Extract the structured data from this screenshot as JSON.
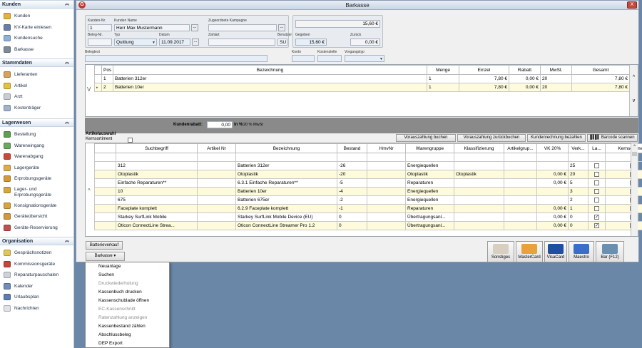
{
  "sidebar": {
    "sections": [
      {
        "title": "Kunden",
        "items": [
          {
            "label": "Kunden",
            "icon": "customers-icon",
            "color": "#e8b23a"
          },
          {
            "label": "KV-Karte einlesen",
            "icon": "card-reader-icon",
            "color": "#6a7fa8"
          },
          {
            "label": "Kundensuche",
            "icon": "customer-search-icon",
            "color": "#8fb0d8"
          },
          {
            "label": "Barkasse",
            "icon": "cash-register-icon",
            "color": "#7d8a99"
          }
        ]
      },
      {
        "title": "Stammdaten",
        "items": [
          {
            "label": "Lieferanten",
            "icon": "supplier-icon",
            "color": "#d9a15a"
          },
          {
            "label": "Artikel",
            "icon": "article-box-icon",
            "color": "#e3c23c"
          },
          {
            "label": "Arzt",
            "icon": "doctor-icon",
            "color": "#c9ccd2"
          },
          {
            "label": "Kostenträger",
            "icon": "payer-icon",
            "color": "#9fb4cc"
          }
        ]
      },
      {
        "title": "Lagerwesen",
        "items": [
          {
            "label": "Bestellung",
            "icon": "order-icon",
            "color": "#5f9e57"
          },
          {
            "label": "Wareneingang",
            "icon": "goods-in-icon",
            "color": "#6aa95f"
          },
          {
            "label": "Warenabgang",
            "icon": "goods-out-icon",
            "color": "#c94c3b"
          },
          {
            "label": "Lagergeräte",
            "icon": "stock-devices-icon",
            "color": "#e0ac4a"
          },
          {
            "label": "Erprobungsgeräte",
            "icon": "trial-devices-icon",
            "color": "#d49a38"
          },
          {
            "label": "Lager- und Erprobungsgeräte",
            "icon": "stock-trial-icon",
            "color": "#d7a641"
          },
          {
            "label": "Konsignationsgeräte",
            "icon": "consignment-icon",
            "color": "#d9a33e"
          },
          {
            "label": "Geräteübersicht",
            "icon": "device-overview-icon",
            "color": "#d2983a"
          },
          {
            "label": "Geräte-Reservierung",
            "icon": "reservation-icon",
            "color": "#c44e4e"
          }
        ]
      },
      {
        "title": "Organisation",
        "items": [
          {
            "label": "Gesprächsnotizen",
            "icon": "notes-icon",
            "color": "#e5c55a"
          },
          {
            "label": "Kommissionsgeräte",
            "icon": "commission-icon",
            "color": "#c8453a"
          },
          {
            "label": "Reparaturpauschalen",
            "icon": "repair-flatrate-icon",
            "color": "#cfd3d9"
          },
          {
            "label": "Kalender",
            "icon": "calendar-icon",
            "color": "#6f8db8"
          },
          {
            "label": "Urlaubsplan",
            "icon": "vacation-plan-icon",
            "color": "#5b7fb0"
          },
          {
            "label": "Nachrichten",
            "icon": "messages-icon",
            "color": "#dfe3e8"
          }
        ]
      }
    ]
  },
  "window": {
    "title": "Barkasse",
    "app_icon": "G",
    "close_label": "X"
  },
  "header": {
    "kunden_nr_label": "Kunden-Nr.",
    "kunden_nr": "1",
    "kunden_name_label": "Kunden Name",
    "kunden_name": "Herr  Max Mustermann",
    "kampagne_label": "Zugeordnete Kampagne",
    "kampagne": "",
    "beleg_nr_label": "Beleg-Nr.",
    "beleg_nr": "",
    "typ_label": "Typ",
    "typ": "Quittung",
    "datum_label": "Datum",
    "datum": "11.09.2017",
    "zahlart_label": "Zahlart",
    "zahlart": "",
    "benutzer_label": "Benutzer",
    "benutzer": "SU",
    "total": "15,60 €",
    "gegeben_label": "Gegeben",
    "gegeben": "15,60 €",
    "zurueck_label": "Zurück",
    "zurueck": "0,00 €",
    "belegtext_label": "Belegtext",
    "belegtext": "",
    "konto_label": "Konto",
    "konto": "",
    "kostenstelle_label": "Kostenstelle",
    "kostenstelle": "",
    "vorgangstyp_label": "Vorgangstyp",
    "vorgangstyp": "",
    "dots_label": "..."
  },
  "positions": {
    "columns": [
      "Pos",
      "Bezeichnung",
      "Menge",
      "Einzel",
      "Rabatt",
      "MwSt.",
      "Gesamt"
    ],
    "rows": [
      {
        "pos": "1",
        "bez": "Batterien 312er",
        "menge": "1",
        "einzel": "7,80 €",
        "rabatt": "0,00 €",
        "mwst": "20",
        "gesamt": "7,80 €"
      },
      {
        "pos": "2",
        "bez": "Batterien 10er",
        "menge": "1",
        "einzel": "7,80 €",
        "rabatt": "0,00 €",
        "mwst": "20",
        "gesamt": "7,80 €"
      }
    ],
    "expand_label": "V",
    "scroll_up": "^",
    "scroll_down": "v"
  },
  "rabatt": {
    "label": "Kundenrabatt:",
    "value": "0,00",
    "in_label": "in %",
    "mwst": "20 % MwSt"
  },
  "artikel": {
    "title": "Artikelauswahl",
    "kernsortiment_label": "Kernsortiment",
    "buttons": {
      "vorauszahlung": "Vorauszahlung buchen",
      "vorauszahlung_zurueck": "Vorauszahlung zurückbuchen",
      "kundenrechnung": "Kundenrechnung bezahlen",
      "barcode": "Barcode scannen"
    },
    "columns": [
      "Suchbegriff",
      "Artikel Nr",
      "Bezeichnung",
      "Bestand",
      "HmvNr",
      "Warengruppe",
      "Klassifizierung",
      "Artikelgrup...",
      "VK 20%",
      "Verk...",
      "La...",
      "Kernsortiment"
    ],
    "rows": [
      {
        "such": "312",
        "nr": "",
        "bez": "Batterien 312er",
        "bestand": "-26",
        "hmv": "",
        "wg": "Energiequellen",
        "klass": "",
        "ag": "",
        "vk": "",
        "verk": "25",
        "la": false,
        "kern": false
      },
      {
        "such": "Otoplastik",
        "nr": "",
        "bez": "Otoplastik",
        "bestand": "-20",
        "hmv": "",
        "wg": "Otoplastik",
        "klass": "Otoplastik",
        "ag": "",
        "vk": "0,00 €",
        "verk": "20",
        "la": false,
        "kern": false
      },
      {
        "such": "Einfache Reparaturen**",
        "nr": "",
        "bez": "6.3.1 Einfache Reparaturen**",
        "bestand": "-5",
        "hmv": "",
        "wg": "Reparaturen",
        "klass": "",
        "ag": "",
        "vk": "0,00 €",
        "verk": "5",
        "la": false,
        "kern": false
      },
      {
        "such": "10",
        "nr": "",
        "bez": "Batterien 10er",
        "bestand": "-4",
        "hmv": "",
        "wg": "Energiequellen",
        "klass": "",
        "ag": "",
        "vk": "",
        "verk": "3",
        "la": false,
        "kern": false
      },
      {
        "such": "675",
        "nr": "",
        "bez": "Batterien 675er",
        "bestand": "-2",
        "hmv": "",
        "wg": "Energiequellen",
        "klass": "",
        "ag": "",
        "vk": "",
        "verk": "2",
        "la": false,
        "kern": false
      },
      {
        "such": "Faceplate komplett",
        "nr": "",
        "bez": "6.2.9 Faceplate komplett",
        "bestand": "-1",
        "hmv": "",
        "wg": "Reparaturen",
        "klass": "",
        "ag": "",
        "vk": "0,00 €",
        "verk": "1",
        "la": false,
        "kern": false
      },
      {
        "such": "Starkey SurfLink Mobile",
        "nr": "",
        "bez": "Starkey SurfLink Mobile Device (EU)",
        "bestand": "0",
        "hmv": "",
        "wg": "Übertragungsanl...",
        "klass": "",
        "ag": "",
        "vk": "0,00 €",
        "verk": "0",
        "la": true,
        "kern": false
      },
      {
        "such": "Oticon ConnectLine Strea...",
        "nr": "",
        "bez": "Oticon ConnectLine Streamer Pro 1.2",
        "bestand": "0",
        "hmv": "",
        "wg": "Übertragungsanl...",
        "klass": "",
        "ag": "",
        "vk": "0,00 €",
        "verk": "0",
        "la": true,
        "kern": false
      }
    ]
  },
  "bottom": {
    "batterieverkauf": "Batterieverkauf",
    "barkasse_dd": "Barkasse",
    "pay": [
      {
        "label": "Sonstiges",
        "icon": "other-payment-icon",
        "color": "#d8cfc0"
      },
      {
        "label": "MasterCard",
        "icon": "mastercard-icon",
        "color": "#e8a23a"
      },
      {
        "label": "VisaCard",
        "icon": "visa-icon",
        "color": "#1f4fa0"
      },
      {
        "label": "Maestro",
        "icon": "maestro-icon",
        "color": "#3a6fc8"
      },
      {
        "label": "Bar (F12)",
        "icon": "cash-icon",
        "color": "#6a8fb0"
      }
    ]
  },
  "menu": {
    "items": [
      {
        "label": "Neuanlage",
        "enabled": true
      },
      {
        "label": "Suchen",
        "enabled": true
      },
      {
        "label": "Druckwiederholung",
        "enabled": false
      },
      {
        "label": "Kassenbuch drucken",
        "enabled": true
      },
      {
        "label": "Kassenschublade öffnen",
        "enabled": true
      },
      {
        "label": "EC-Kassenschnitt",
        "enabled": false
      },
      {
        "label": "Ratenzahlung anzeigen",
        "enabled": false
      },
      {
        "label": "Kassenbestand zählen",
        "enabled": true
      },
      {
        "label": "Abschlussbeleg",
        "enabled": true
      },
      {
        "label": "DEP Export",
        "enabled": true
      }
    ]
  }
}
